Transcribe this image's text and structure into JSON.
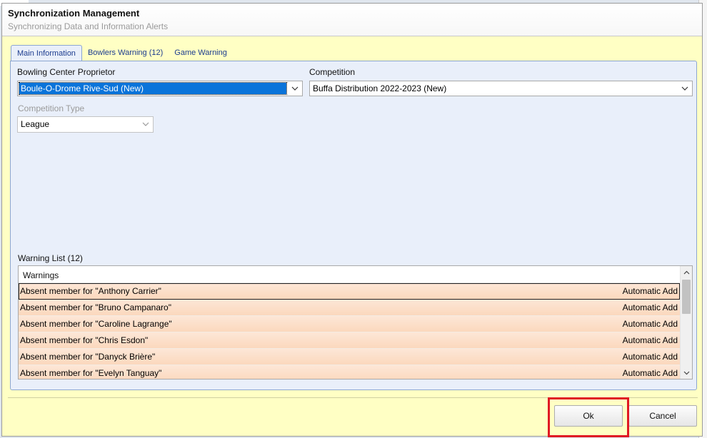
{
  "dialog": {
    "title": "Synchronization Management",
    "subtitle": "Synchronizing Data and Information Alerts"
  },
  "tabs": [
    {
      "label": "Main Information",
      "active": true
    },
    {
      "label": "Bowlers Warning (12)",
      "active": false
    },
    {
      "label": "Game Warning",
      "active": false
    }
  ],
  "form": {
    "proprietor_label": "Bowling Center Proprietor",
    "proprietor_value": "Boule-O-Drome Rive-Sud (New)",
    "competition_label": "Competition",
    "competition_value": "Buffa Distribution 2022-2023 (New)",
    "competition_type_label": "Competition Type",
    "competition_type_value": "League"
  },
  "warning_list": {
    "label": "Warning List (12)",
    "column_header": "Warnings",
    "rows": [
      {
        "message": "Absent member for \"Anthony Carrier\"",
        "action": "Automatic Add"
      },
      {
        "message": "Absent member for \"Bruno Campanaro\"",
        "action": "Automatic Add"
      },
      {
        "message": "Absent member for \"Caroline Lagrange\"",
        "action": "Automatic Add"
      },
      {
        "message": "Absent member for \"Chris Esdon\"",
        "action": "Automatic Add"
      },
      {
        "message": "Absent member for \"Danyck Brière\"",
        "action": "Automatic Add"
      },
      {
        "message": "Absent member for \"Evelyn Tanguay\"",
        "action": "Automatic Add"
      }
    ]
  },
  "buttons": {
    "ok": "Ok",
    "cancel": "Cancel"
  },
  "colors": {
    "dialog_bg": "#ffffc4",
    "panel_bg": "#e9effa",
    "row_bg": "#fbd8bd",
    "selection": "#0a74da",
    "highlight_box": "#e01923"
  }
}
